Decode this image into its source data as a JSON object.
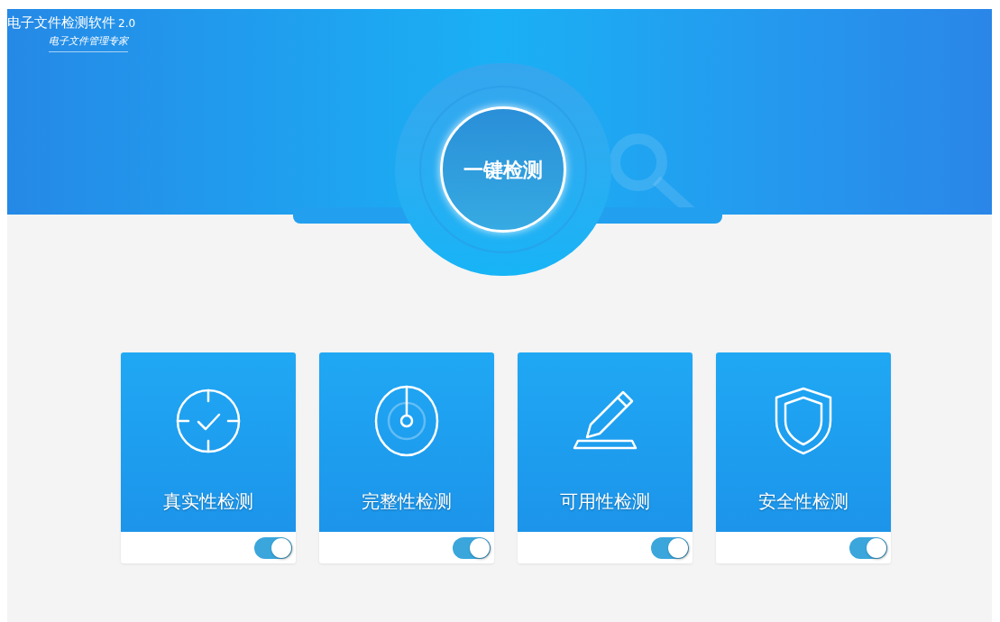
{
  "app": {
    "title": "电子文件检测软件",
    "version": "2.0",
    "subtitle": "电子文件管理专家"
  },
  "main_button": {
    "label": "一键检测"
  },
  "cards": [
    {
      "kind": "target",
      "label": "真实性检测",
      "on": true
    },
    {
      "kind": "dial",
      "label": "完整性检测",
      "on": true
    },
    {
      "kind": "pen",
      "label": "可用性检测",
      "on": true
    },
    {
      "kind": "shield",
      "label": "安全性检测",
      "on": true
    }
  ]
}
